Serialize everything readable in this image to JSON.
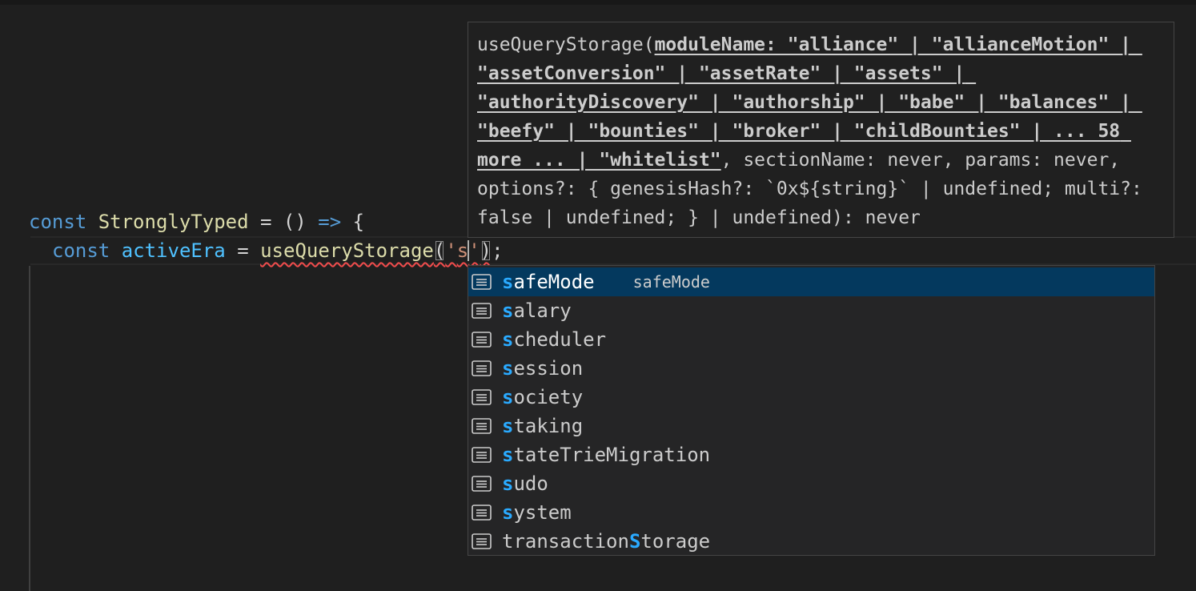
{
  "editor": {
    "line1": {
      "keyword": "const",
      "name": "StronglyTyped",
      "assign": "=",
      "parens": "()",
      "arrow": "=>",
      "brace": "{"
    },
    "line2": {
      "keyword": "const",
      "name": "activeEra",
      "assign": "=",
      "callee": "useQueryStorage",
      "open_paren": "(",
      "quote_open": "'",
      "typed": "s",
      "quote_close": "'",
      "close_paren": ")",
      "semicolon": ";"
    }
  },
  "hover": {
    "fn_name": "useQueryStorage(",
    "param_text": "moduleName: \"alliance\" | \"allianceMotion\" | \"assetConversion\" | \"assetRate\" | \"assets\" | \"authorityDiscovery\" | \"authorship\" | \"babe\" | \"balances\" | \"beefy\" | \"bounties\" | \"broker\" | \"childBounties\" | ... 58 more ... | \"whitelist\"",
    "rest_text": ", sectionName: never, params: never, options?: { genesisHash?: `0x${string}` | undefined; multi?: false | undefined; } | undefined): never"
  },
  "suggestions": {
    "selected_detail": "safeMode",
    "items": [
      {
        "before": "",
        "match": "s",
        "after": "afeMode",
        "icon": "text-icon",
        "selected": true
      },
      {
        "before": "",
        "match": "s",
        "after": "alary",
        "icon": "text-icon"
      },
      {
        "before": "",
        "match": "s",
        "after": "cheduler",
        "icon": "text-icon"
      },
      {
        "before": "",
        "match": "s",
        "after": "ession",
        "icon": "text-icon"
      },
      {
        "before": "",
        "match": "s",
        "after": "ociety",
        "icon": "text-icon"
      },
      {
        "before": "",
        "match": "s",
        "after": "taking",
        "icon": "text-icon"
      },
      {
        "before": "",
        "match": "s",
        "after": "tateTrieMigration",
        "icon": "text-icon"
      },
      {
        "before": "",
        "match": "s",
        "after": "udo",
        "icon": "text-icon"
      },
      {
        "before": "",
        "match": "s",
        "after": "ystem",
        "icon": "text-icon"
      },
      {
        "before": "transaction",
        "match": "S",
        "after": "torage",
        "icon": "text-icon"
      }
    ]
  },
  "colors": {
    "background": "#1f1f1f",
    "keyword": "#569cd6",
    "function": "#dcdcaa",
    "variable": "#4fc1ff",
    "string": "#ce9178",
    "match_highlight": "#2aaaff",
    "selection": "#04395e",
    "error_squiggle": "#f14c4c"
  }
}
